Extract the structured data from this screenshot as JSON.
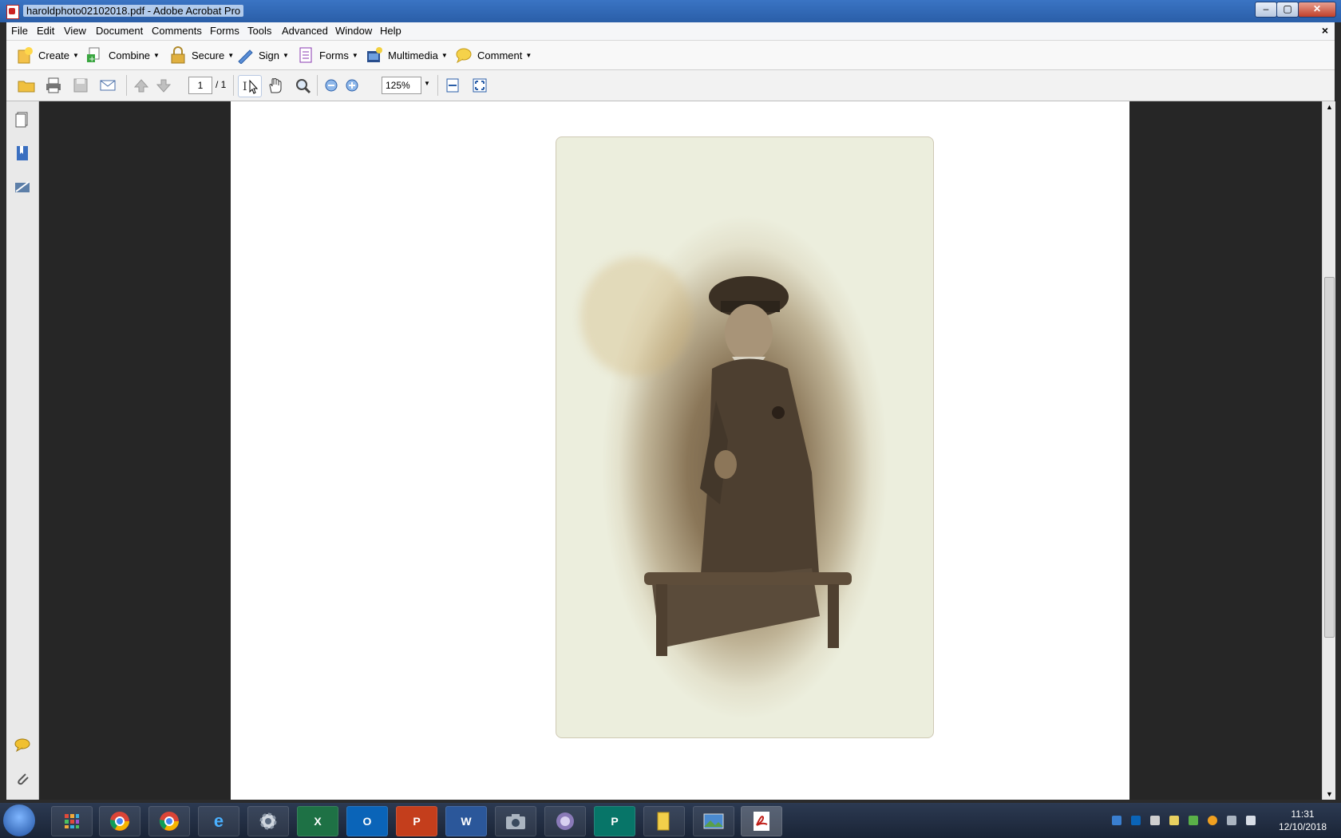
{
  "window": {
    "title": "haroldphoto02102018.pdf - Adobe Acrobat Pro"
  },
  "menu": [
    "File",
    "Edit",
    "View",
    "Document",
    "Comments",
    "Forms",
    "Tools",
    "Advanced",
    "Window",
    "Help"
  ],
  "tasks": {
    "create": "Create",
    "combine": "Combine",
    "secure": "Secure",
    "sign": "Sign",
    "forms": "Forms",
    "multimedia": "Multimedia",
    "comment": "Comment"
  },
  "nav": {
    "page_current": "1",
    "page_total": "/ 1",
    "zoom": "125%"
  },
  "clock": {
    "time": "11:31",
    "date": "12/10/2018"
  },
  "colors": {
    "title_bar": "#2a5ea8",
    "doc_bg": "#262626",
    "taskbar": "#1a2436"
  }
}
